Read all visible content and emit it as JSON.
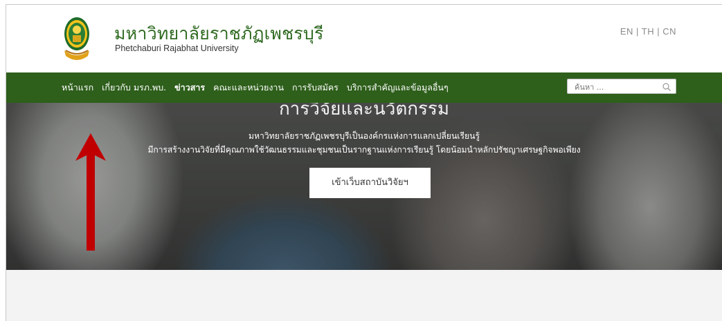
{
  "header": {
    "title": "มหาวิทยาลัยราชภัฏเพชรบุรี",
    "subtitle": "Phetchaburi Rajabhat University",
    "languages": [
      "EN",
      "TH",
      "CN"
    ],
    "lang_separator": " | "
  },
  "nav": {
    "items": [
      {
        "label": "หน้าแรก",
        "active": false
      },
      {
        "label": "เกี่ยวกับ มรภ.พบ.",
        "active": false
      },
      {
        "label": "ข่าวสาร",
        "active": true
      },
      {
        "label": "คณะและหน่วยงาน",
        "active": false
      },
      {
        "label": "การรับสมัคร",
        "active": false
      },
      {
        "label": "บริการสำคัญและข้อมูลอื่นๆ",
        "active": false
      }
    ],
    "search_placeholder": "ค้นหา ..."
  },
  "hero": {
    "heading": "การวิจัยและนวัตกรรม",
    "line1": "มหาวิทยาลัยราชภัฏเพชรบุรีเป็นองค์กรแห่งการแลกเปลี่ยนเรียนรู้",
    "line2": "มีการสร้างงานวิจัยที่มีคุณภาพใช้วัฒนธรรมและชุมชนเป็นรากฐานแห่งการเรียนรู้ โดยน้อมนำหลักปรัชญาเศรษฐกิจพอเพียง",
    "button_label": "เข้าเว็บสถาบันวิจัยฯ"
  },
  "icons": {
    "logo": "university-seal-icon",
    "search": "search-icon",
    "annotation_arrow": "up-arrow-icon"
  },
  "colors": {
    "brand_green": "#2e5f1b",
    "title_green": "#2f6a21",
    "arrow_red": "#c00000"
  }
}
